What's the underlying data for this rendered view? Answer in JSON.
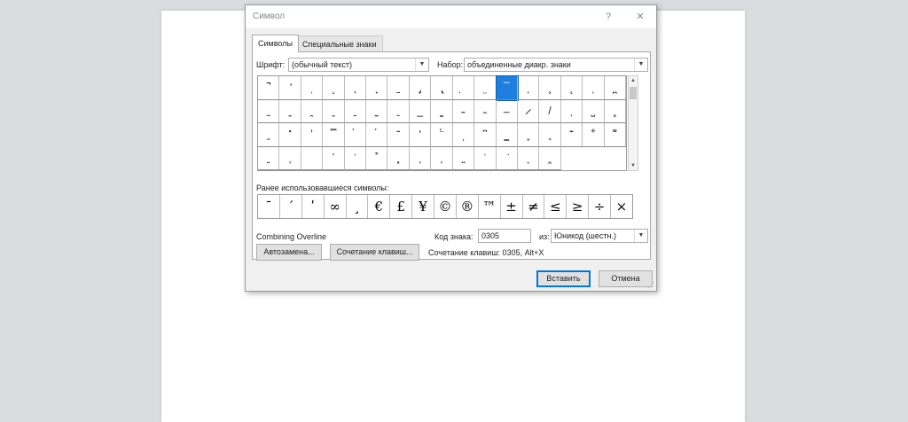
{
  "dialog": {
    "title": "Символ",
    "help": "?",
    "close": "✕"
  },
  "tabs": [
    {
      "label": "Символы"
    },
    {
      "label": "Специальные знаки"
    }
  ],
  "font": {
    "label": "Шрифт:",
    "value": "(обычный текст)"
  },
  "subset": {
    "label": "Набор:",
    "value": "объединенные диакр. знаки"
  },
  "symbols": [
    "̚",
    "̛",
    "̜",
    "̝",
    "̞",
    "̟",
    "̠",
    "̡",
    "̢",
    "̣",
    "̤",
    "̥",
    "̦",
    "̧",
    "̨",
    "̩",
    "̪",
    "̫",
    "̬",
    "̭",
    "̮",
    "̯",
    "̰",
    "̱",
    "̲",
    "̳",
    "̴",
    "̵",
    "̶",
    "̷",
    "̸",
    "̹",
    "̺",
    "̻",
    "̼",
    "̽",
    "̾",
    "̿",
    "̀",
    "́",
    "͂",
    "̓",
    "̈́",
    "ͅ",
    "͆",
    "͇",
    "͈",
    "͉",
    "͊",
    "͋",
    "͌",
    "͍",
    "͎",
    "͏",
    "͐",
    "͑",
    "͒",
    "͓",
    "͔",
    "͕",
    "͖",
    "͗",
    "͘",
    "͙",
    "͚"
  ],
  "selected_symbol": "̅",
  "recent": {
    "label": "Ранее использовавшиеся символы:",
    "items": [
      "¯",
      "ˊ",
      "ʹ",
      "∞",
      "¸",
      "€",
      "£",
      "¥",
      "©",
      "®",
      "™",
      "±",
      "≠",
      "≤",
      "≥",
      "÷",
      "×"
    ]
  },
  "char_name": "Combining Overline",
  "code": {
    "label": "Код знака:",
    "value": "0305"
  },
  "from": {
    "label": "из:",
    "value": "Юникод (шестн.)"
  },
  "autocorrect_button": "Автозамена...",
  "shortcut_button": "Сочетание клавиш...",
  "shortcut_text": "Сочетание клавиш: 0305, Alt+X",
  "insert_button": "Вставить",
  "cancel_button": "Отмена"
}
